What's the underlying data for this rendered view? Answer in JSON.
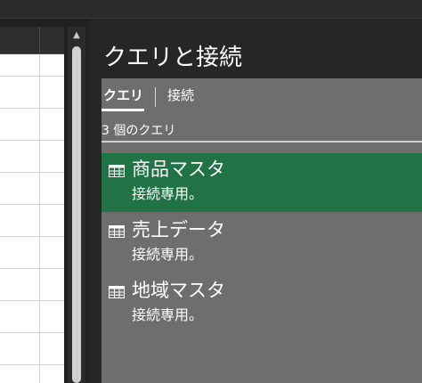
{
  "panel": {
    "title": "クエリと接続",
    "tabs": [
      {
        "label": "クエリ",
        "active": true
      },
      {
        "label": "接続",
        "active": false
      }
    ],
    "query_count": "3 個のクエリ",
    "queries": [
      {
        "name": "商品マスタ",
        "status": "接続専用。",
        "selected": true,
        "icon": "table-icon"
      },
      {
        "name": "売上データ",
        "status": "接続専用。",
        "selected": false,
        "icon": "table-icon"
      },
      {
        "name": "地域マスタ",
        "status": "接続専用。",
        "selected": false,
        "icon": "table-icon"
      }
    ]
  },
  "colors": {
    "selected_bg": "#217346",
    "panel_body_bg": "#6e6e6e",
    "panel_bg": "#262626"
  }
}
